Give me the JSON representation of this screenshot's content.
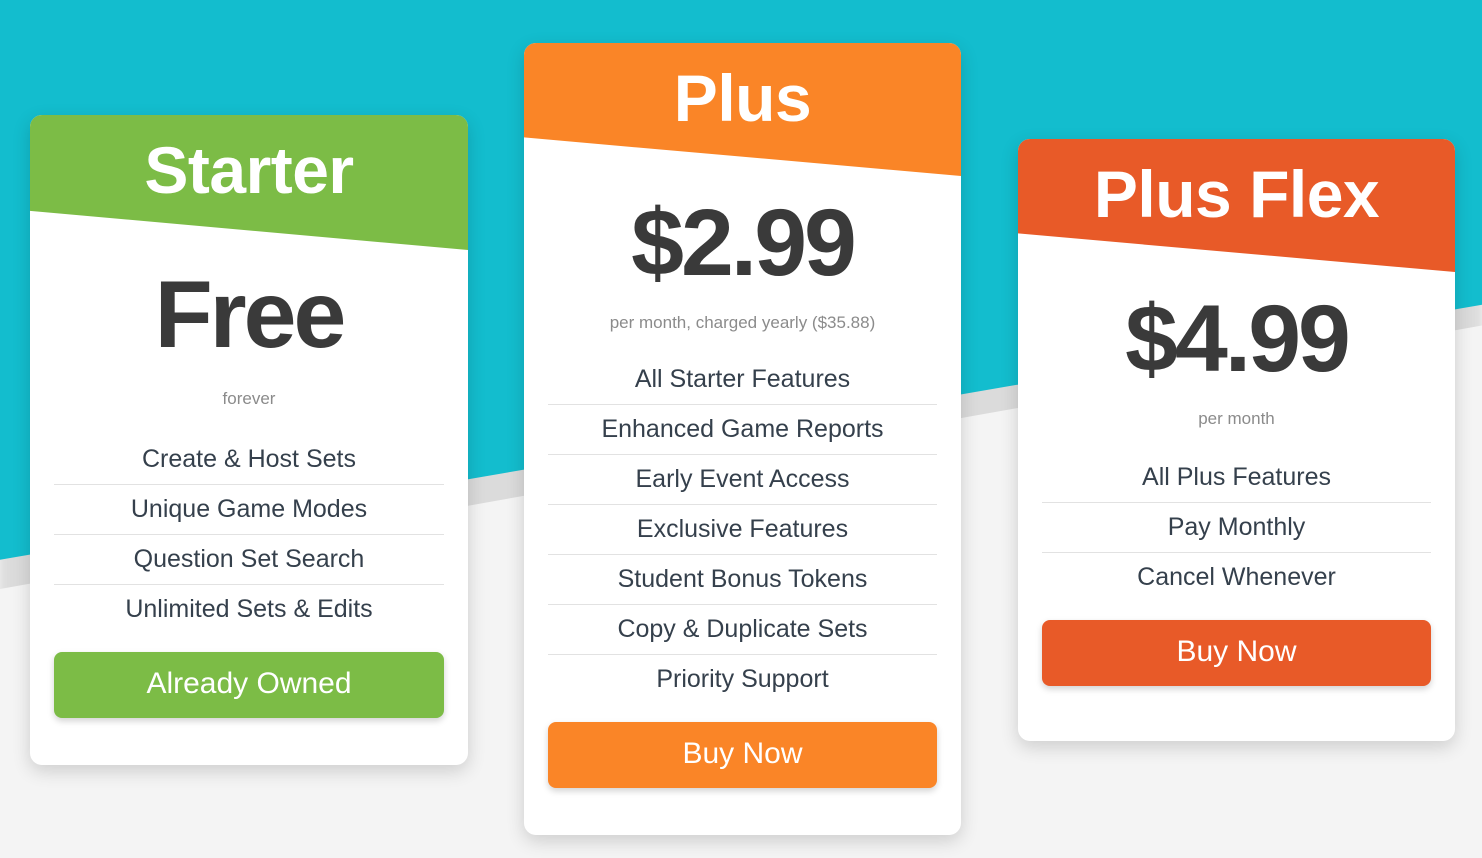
{
  "background": {
    "band_color": "#13bdce",
    "page_color": "#f4f4f4"
  },
  "plans": [
    {
      "id": "starter",
      "name": "Starter",
      "accent_color": "#7cbc46",
      "price": "Free",
      "price_note": "forever",
      "features": [
        "Create & Host Sets",
        "Unique Game Modes",
        "Question Set Search",
        "Unlimited Sets & Edits"
      ],
      "cta_label": "Already Owned"
    },
    {
      "id": "plus",
      "name": "Plus",
      "accent_color": "#fa8527",
      "price": "$2.99",
      "price_note": "per month, charged yearly ($35.88)",
      "features": [
        "All Starter Features",
        "Enhanced Game Reports",
        "Early Event Access",
        "Exclusive Features",
        "Student Bonus Tokens",
        "Copy & Duplicate Sets",
        "Priority Support"
      ],
      "cta_label": "Buy Now"
    },
    {
      "id": "plusflex",
      "name": "Plus Flex",
      "accent_color": "#e85a28",
      "price": "$4.99",
      "price_note": "per month",
      "features": [
        "All Plus Features",
        "Pay Monthly",
        "Cancel Whenever"
      ],
      "cta_label": "Buy Now"
    }
  ]
}
